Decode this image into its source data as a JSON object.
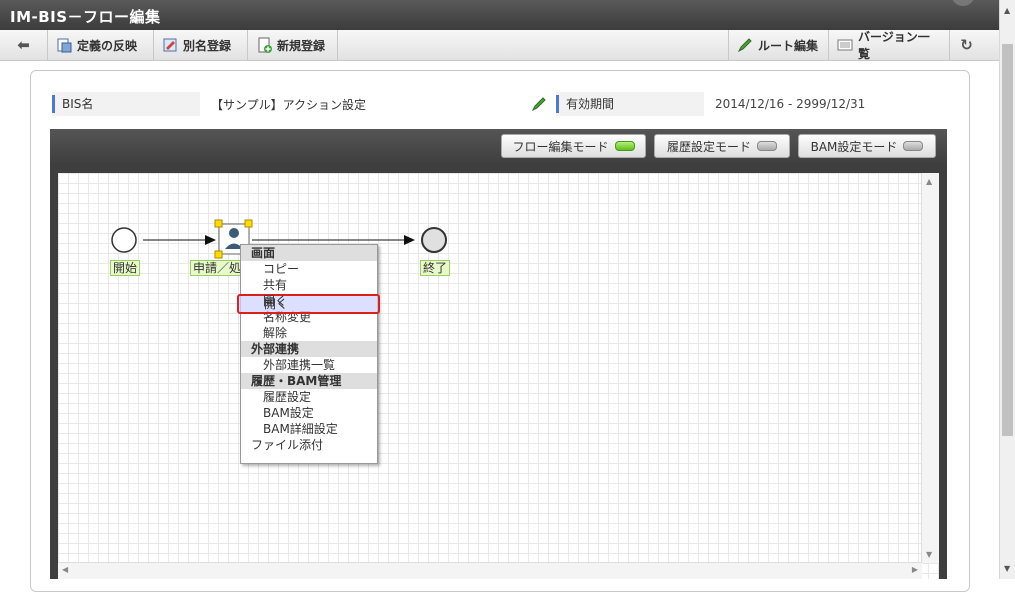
{
  "title": "IM-BIS－フロー編集",
  "toolbar": {
    "back_label": "",
    "apply_definition": "定義の反映",
    "save_as": "別名登録",
    "new_register": "新規登録",
    "route_edit": "ルート編集",
    "version_list": "バージョン一覧"
  },
  "info": {
    "bis_name_label": "BIS名",
    "bis_name_value": "【サンプル】アクション設定",
    "valid_period_label": "有効期間",
    "valid_period_value": "2014/12/16 ‐ 2999/12/31"
  },
  "modes": {
    "flow_edit": "フロー編集モード",
    "history": "履歴設定モード",
    "bam": "BAM設定モード"
  },
  "flow": {
    "start_label": "開始",
    "task_label": "申請／処",
    "end_label": "終了"
  },
  "context_menu": {
    "section_screen": "画面",
    "copy": "コピー",
    "share": "共有",
    "open": "開く",
    "rename": "名称変更",
    "release": "解除",
    "section_external": "外部連携",
    "external_list": "外部連携一覧",
    "section_history": "履歴・BAM管理",
    "history_setting": "履歴設定",
    "bam_setting": "BAM設定",
    "bam_detail": "BAM詳細設定",
    "attach_file": "ファイル添付"
  },
  "colors": {
    "accent": "#4d7bd1",
    "highlight_border": "#d9201c",
    "led_on": "#5fbf1c"
  }
}
